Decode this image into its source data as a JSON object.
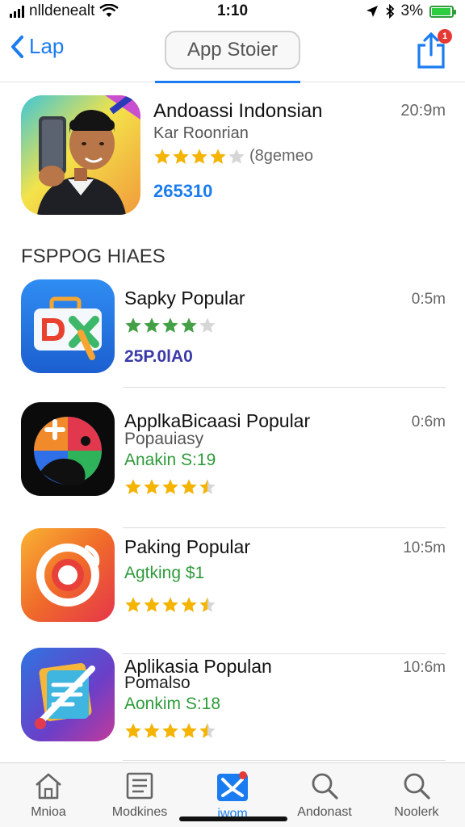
{
  "status_bar": {
    "carrier": "nlldenealt",
    "time": "1:10",
    "battery": "3%"
  },
  "nav": {
    "back_label": "Lap",
    "title": "App Stoier",
    "badge": "1"
  },
  "featured": {
    "name": "Andoassi Indonsian",
    "subtitle": "Kar Roonrian",
    "rating_text": "(8gemeo",
    "price": "265310",
    "time": "20:9m",
    "rating": 4
  },
  "section_title": "FSPPOG HIAES",
  "apps": [
    {
      "name": "Sapky Popular",
      "time": "0:5m",
      "price": "25P.0lA0",
      "rating": 4
    },
    {
      "name": "ApplkaBicaasi Popular",
      "time": "0:6m",
      "subtitle": "Popauiasy",
      "developer": "Anakin S:19",
      "rating": 4.5
    },
    {
      "name": "Paking Popular",
      "time": "10:5m",
      "developer": "Agtking $1",
      "rating": 4.5
    },
    {
      "name": "Aplikasia Populan",
      "time": "10:6m",
      "subtitle": "Pomalso",
      "developer": "Aonkim S:18",
      "rating": 4.5
    }
  ],
  "tabs": [
    {
      "label": "Mnioa",
      "icon": "home-icon"
    },
    {
      "label": "Modkines",
      "icon": "list-icon"
    },
    {
      "label": "iwom",
      "icon": "apps-icon"
    },
    {
      "label": "Andonast",
      "icon": "search-icon"
    },
    {
      "label": "Noolerk",
      "icon": "search-icon"
    }
  ],
  "colors": {
    "accent": "#1a7cf0",
    "star_gold": "#f4b400",
    "star_green": "#43a047",
    "developer_green": "#2e9b3a"
  }
}
